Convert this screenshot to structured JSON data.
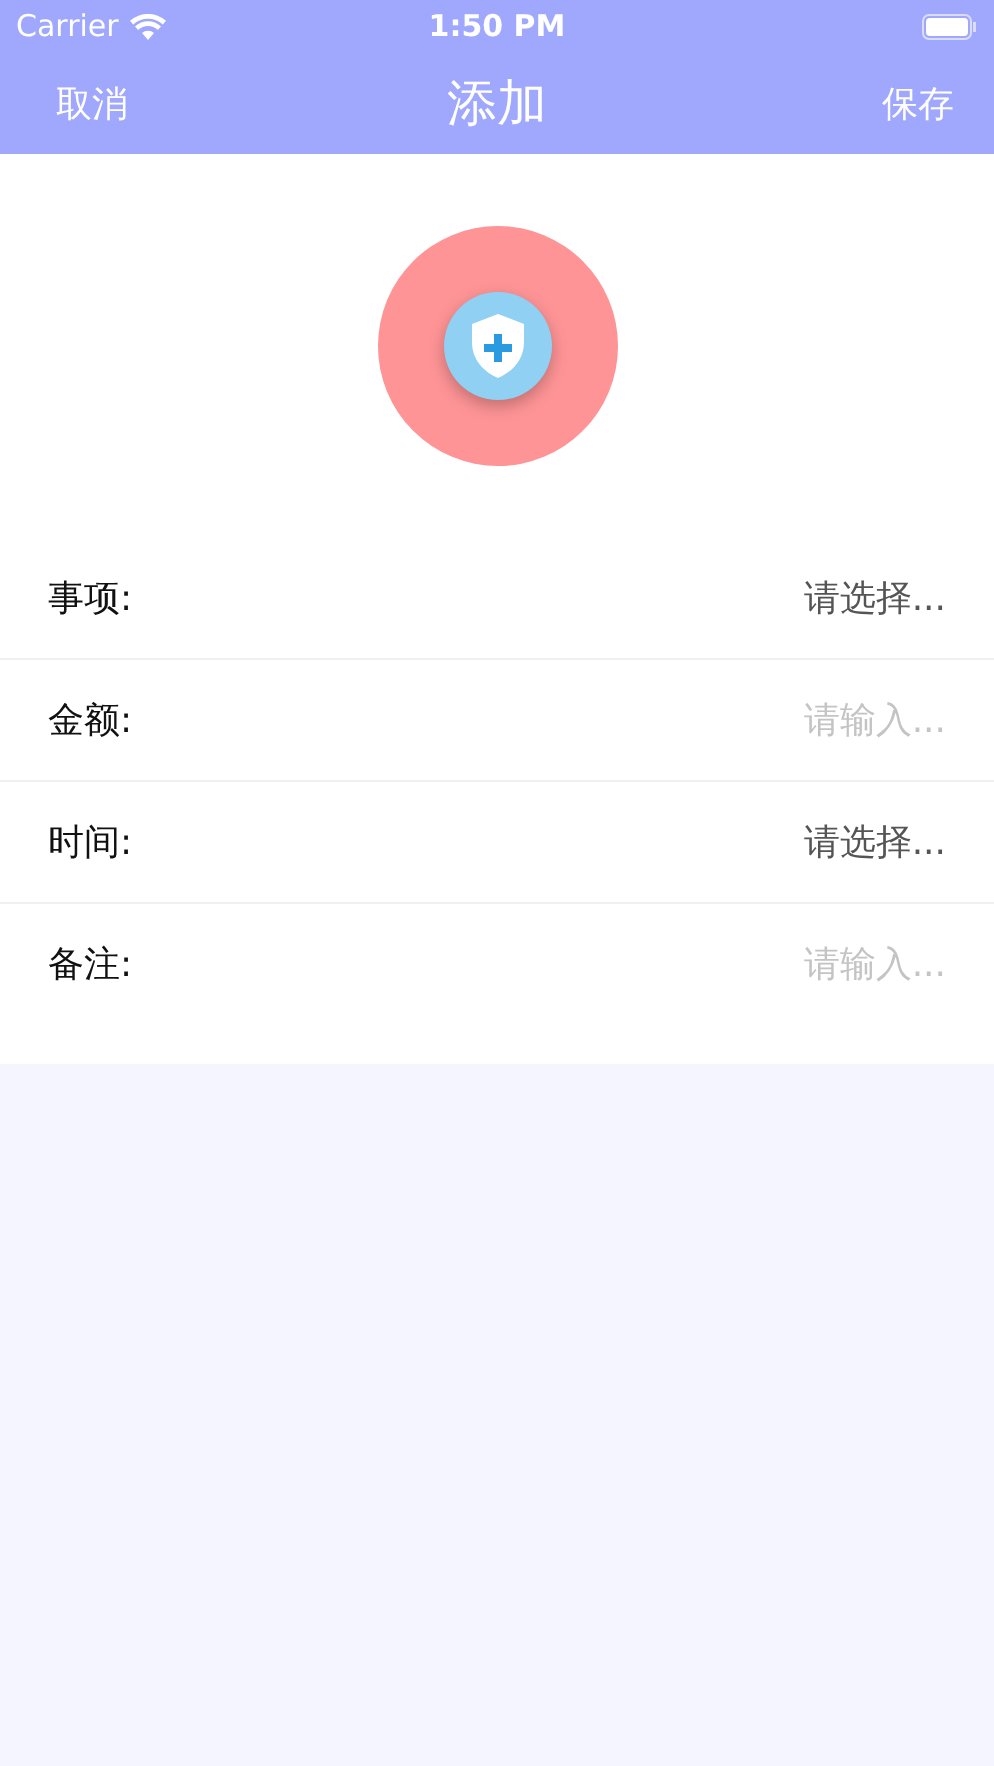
{
  "status_bar": {
    "carrier": "Carrier",
    "time": "1:50 PM"
  },
  "nav": {
    "left": "取消",
    "title": "添加",
    "right": "保存"
  },
  "fields": [
    {
      "kind": "select",
      "label": "事项:",
      "value": "请选择..."
    },
    {
      "kind": "input",
      "label": "金额:",
      "placeholder": "请输入..."
    },
    {
      "kind": "select",
      "label": "时间:",
      "value": "请选择..."
    },
    {
      "kind": "input",
      "label": "备注:",
      "placeholder": "请输入..."
    }
  ]
}
